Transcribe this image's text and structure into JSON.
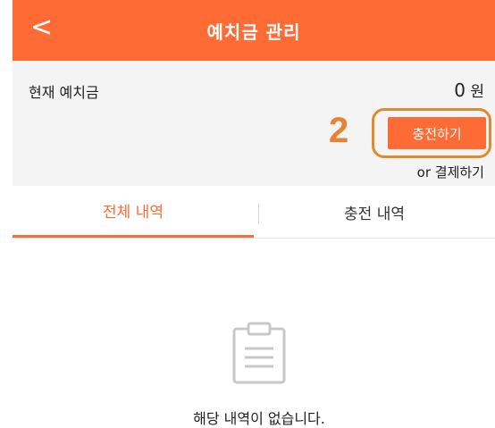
{
  "header": {
    "back_label": "<",
    "title": "예치금 관리"
  },
  "balance": {
    "label": "현재 예치금",
    "amount": "0",
    "unit": "원",
    "annotation_number": "2",
    "charge_button": "충전하기",
    "alt_pay": "or 결제하기"
  },
  "tabs": [
    {
      "label": "전체 내역",
      "active": true
    },
    {
      "label": "충전 내역",
      "active": false
    }
  ],
  "empty": {
    "icon": "clipboard-icon",
    "message": "해당 내역이 없습니다."
  },
  "colors": {
    "accent": "#ff6b35",
    "annotation": "#e8822e",
    "panel": "#f4f4f4"
  }
}
